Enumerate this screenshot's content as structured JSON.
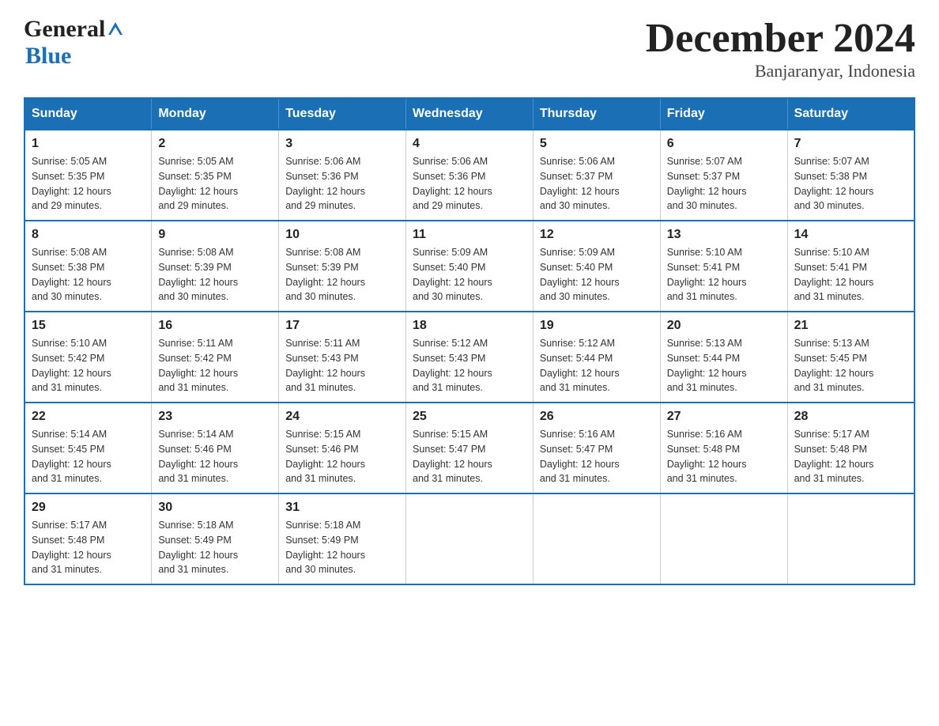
{
  "header": {
    "logo_general": "General",
    "logo_blue": "Blue",
    "month_title": "December 2024",
    "subtitle": "Banjaranyar, Indonesia"
  },
  "calendar": {
    "days": [
      "Sunday",
      "Monday",
      "Tuesday",
      "Wednesday",
      "Thursday",
      "Friday",
      "Saturday"
    ],
    "weeks": [
      [
        {
          "day": "1",
          "sunrise": "5:05 AM",
          "sunset": "5:35 PM",
          "daylight": "12 hours and 29 minutes."
        },
        {
          "day": "2",
          "sunrise": "5:05 AM",
          "sunset": "5:35 PM",
          "daylight": "12 hours and 29 minutes."
        },
        {
          "day": "3",
          "sunrise": "5:06 AM",
          "sunset": "5:36 PM",
          "daylight": "12 hours and 29 minutes."
        },
        {
          "day": "4",
          "sunrise": "5:06 AM",
          "sunset": "5:36 PM",
          "daylight": "12 hours and 29 minutes."
        },
        {
          "day": "5",
          "sunrise": "5:06 AM",
          "sunset": "5:37 PM",
          "daylight": "12 hours and 30 minutes."
        },
        {
          "day": "6",
          "sunrise": "5:07 AM",
          "sunset": "5:37 PM",
          "daylight": "12 hours and 30 minutes."
        },
        {
          "day": "7",
          "sunrise": "5:07 AM",
          "sunset": "5:38 PM",
          "daylight": "12 hours and 30 minutes."
        }
      ],
      [
        {
          "day": "8",
          "sunrise": "5:08 AM",
          "sunset": "5:38 PM",
          "daylight": "12 hours and 30 minutes."
        },
        {
          "day": "9",
          "sunrise": "5:08 AM",
          "sunset": "5:39 PM",
          "daylight": "12 hours and 30 minutes."
        },
        {
          "day": "10",
          "sunrise": "5:08 AM",
          "sunset": "5:39 PM",
          "daylight": "12 hours and 30 minutes."
        },
        {
          "day": "11",
          "sunrise": "5:09 AM",
          "sunset": "5:40 PM",
          "daylight": "12 hours and 30 minutes."
        },
        {
          "day": "12",
          "sunrise": "5:09 AM",
          "sunset": "5:40 PM",
          "daylight": "12 hours and 30 minutes."
        },
        {
          "day": "13",
          "sunrise": "5:10 AM",
          "sunset": "5:41 PM",
          "daylight": "12 hours and 31 minutes."
        },
        {
          "day": "14",
          "sunrise": "5:10 AM",
          "sunset": "5:41 PM",
          "daylight": "12 hours and 31 minutes."
        }
      ],
      [
        {
          "day": "15",
          "sunrise": "5:10 AM",
          "sunset": "5:42 PM",
          "daylight": "12 hours and 31 minutes."
        },
        {
          "day": "16",
          "sunrise": "5:11 AM",
          "sunset": "5:42 PM",
          "daylight": "12 hours and 31 minutes."
        },
        {
          "day": "17",
          "sunrise": "5:11 AM",
          "sunset": "5:43 PM",
          "daylight": "12 hours and 31 minutes."
        },
        {
          "day": "18",
          "sunrise": "5:12 AM",
          "sunset": "5:43 PM",
          "daylight": "12 hours and 31 minutes."
        },
        {
          "day": "19",
          "sunrise": "5:12 AM",
          "sunset": "5:44 PM",
          "daylight": "12 hours and 31 minutes."
        },
        {
          "day": "20",
          "sunrise": "5:13 AM",
          "sunset": "5:44 PM",
          "daylight": "12 hours and 31 minutes."
        },
        {
          "day": "21",
          "sunrise": "5:13 AM",
          "sunset": "5:45 PM",
          "daylight": "12 hours and 31 minutes."
        }
      ],
      [
        {
          "day": "22",
          "sunrise": "5:14 AM",
          "sunset": "5:45 PM",
          "daylight": "12 hours and 31 minutes."
        },
        {
          "day": "23",
          "sunrise": "5:14 AM",
          "sunset": "5:46 PM",
          "daylight": "12 hours and 31 minutes."
        },
        {
          "day": "24",
          "sunrise": "5:15 AM",
          "sunset": "5:46 PM",
          "daylight": "12 hours and 31 minutes."
        },
        {
          "day": "25",
          "sunrise": "5:15 AM",
          "sunset": "5:47 PM",
          "daylight": "12 hours and 31 minutes."
        },
        {
          "day": "26",
          "sunrise": "5:16 AM",
          "sunset": "5:47 PM",
          "daylight": "12 hours and 31 minutes."
        },
        {
          "day": "27",
          "sunrise": "5:16 AM",
          "sunset": "5:48 PM",
          "daylight": "12 hours and 31 minutes."
        },
        {
          "day": "28",
          "sunrise": "5:17 AM",
          "sunset": "5:48 PM",
          "daylight": "12 hours and 31 minutes."
        }
      ],
      [
        {
          "day": "29",
          "sunrise": "5:17 AM",
          "sunset": "5:48 PM",
          "daylight": "12 hours and 31 minutes."
        },
        {
          "day": "30",
          "sunrise": "5:18 AM",
          "sunset": "5:49 PM",
          "daylight": "12 hours and 31 minutes."
        },
        {
          "day": "31",
          "sunrise": "5:18 AM",
          "sunset": "5:49 PM",
          "daylight": "12 hours and 30 minutes."
        },
        null,
        null,
        null,
        null
      ]
    ],
    "labels": {
      "sunrise": "Sunrise:",
      "sunset": "Sunset:",
      "daylight": "Daylight:"
    }
  }
}
